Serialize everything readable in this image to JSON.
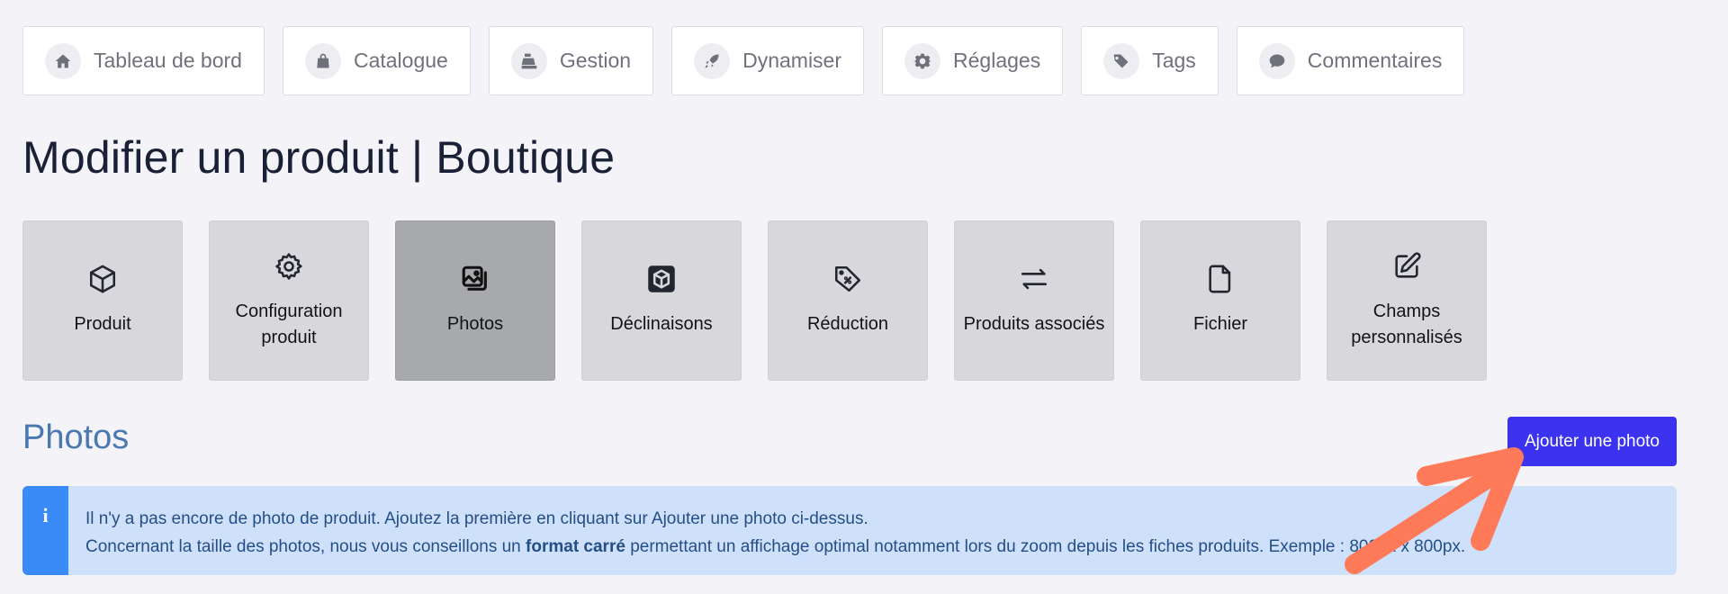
{
  "nav": {
    "items": [
      {
        "label": "Tableau de bord",
        "icon": "home-icon"
      },
      {
        "label": "Catalogue",
        "icon": "shopping-bag-icon"
      },
      {
        "label": "Gestion",
        "icon": "cash-register-icon"
      },
      {
        "label": "Dynamiser",
        "icon": "rocket-icon"
      },
      {
        "label": "Réglages",
        "icon": "gear-icon"
      },
      {
        "label": "Tags",
        "icon": "tags-icon"
      },
      {
        "label": "Commentaires",
        "icon": "comment-icon"
      }
    ]
  },
  "page": {
    "title": "Modifier un produit | Boutique"
  },
  "tabs": {
    "active": "Photos",
    "items": [
      {
        "label": "Produit",
        "icon": "cube-icon"
      },
      {
        "label": "Configuration produit",
        "icon": "gear-icon"
      },
      {
        "label": "Photos",
        "icon": "photos-icon"
      },
      {
        "label": "Déclinaisons",
        "icon": "cube-box-icon"
      },
      {
        "label": "Réduction",
        "icon": "discount-tag-icon"
      },
      {
        "label": "Produits associés",
        "icon": "swap-arrows-icon"
      },
      {
        "label": "Fichier",
        "icon": "file-icon"
      },
      {
        "label": "Champs personnalisés",
        "icon": "edit-icon"
      }
    ]
  },
  "photos": {
    "section_title": "Photos",
    "add_button_label": "Ajouter une photo",
    "info": {
      "icon_glyph": "i",
      "line1": "Il n'y a pas encore de photo de produit. Ajoutez la première en cliquant sur Ajouter une photo ci-dessus.",
      "line2_before": "Concernant la taille des photos, nous vous conseillons un ",
      "line2_bold": "format carré",
      "line2_after": " permettant un affichage optimal notamment lors du zoom depuis les fiches produits. Exemple : 800px x 800px."
    }
  },
  "colors": {
    "accent_button": "#3c33f0",
    "section_title": "#4a78b0",
    "info_background": "#cfe0fb",
    "info_bar": "#3a8af7",
    "annotation_arrow": "#ff7a59"
  }
}
